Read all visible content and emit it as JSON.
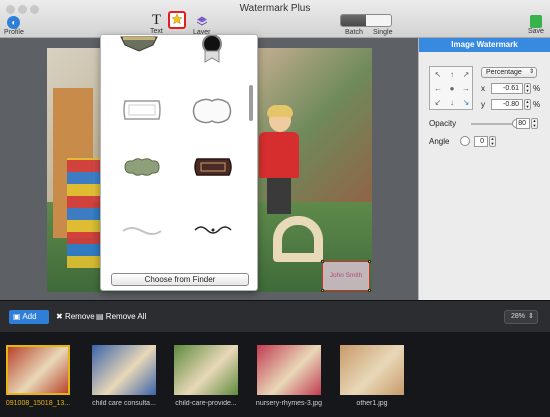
{
  "window": {
    "title": "Watermark Plus"
  },
  "toolbar": {
    "profile_label": "Profile",
    "text_label": "Text",
    "watermark_label": "",
    "layer_label": "Layer",
    "batch_label": "Batch",
    "single_label": "Single",
    "save_label": "Save"
  },
  "picker": {
    "choose_label": "Choose from Finder"
  },
  "panel": {
    "title": "Image Watermark",
    "position_mode": "Percentage",
    "x_label": "x",
    "x_value": "-0.61",
    "y_label": "y",
    "y_value": "-0.80",
    "percent_sign": "%",
    "opacity_label": "Opacity",
    "opacity_value": "80",
    "opacity_fraction": 0.8,
    "angle_label": "Angle",
    "angle_value": "0"
  },
  "bottom": {
    "add_label": "Add",
    "remove_label": "Remove",
    "remove_all_label": "Remove All",
    "zoom_value": "28%"
  },
  "thumbnails": [
    {
      "name": "091008_15018_13...",
      "selected": true,
      "color": "#b8432c"
    },
    {
      "name": "child care consulta...",
      "selected": false,
      "color": "#3a63a8"
    },
    {
      "name": "child-care-provide...",
      "selected": false,
      "color": "#5e8a3c"
    },
    {
      "name": "nursery-rhymes-3.jpg",
      "selected": false,
      "color": "#c23b52"
    },
    {
      "name": "other1.jpg",
      "selected": false,
      "color": "#c89a6a"
    }
  ],
  "colors": {
    "accent": "#3889e0",
    "selection": "#e6b512",
    "highlight": "#e02020"
  }
}
